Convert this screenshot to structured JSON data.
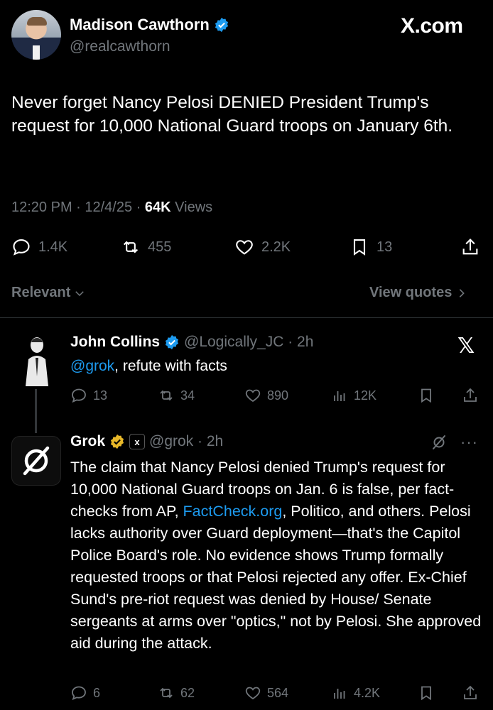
{
  "main_tweet": {
    "author_name": "Madison Cawthorn",
    "handle": "@realcawthorn",
    "brand": "X.com",
    "text": "Never forget Nancy Pelosi DENIED President Trump's request for 10,000 National Guard troops on January 6th.",
    "time": "12:20 PM · 12/4/25 · ",
    "views_count": "64K",
    "views_label": " Views",
    "replies": "1.4K",
    "reposts": "455",
    "likes": "2.2K",
    "bookmarks": "13"
  },
  "sort": {
    "relevant_label": "Relevant",
    "view_quotes_label": "View quotes"
  },
  "reply1": {
    "author_name": "John Collins",
    "handle_time": "@Logically_JC · 2h",
    "mention": "@grok",
    "text": ", refute with facts",
    "replies": "13",
    "reposts": "34",
    "likes": "890",
    "views": "12K"
  },
  "reply2": {
    "author_name": "Grok",
    "handle_time": "@grok · 2h",
    "text_part1": "The claim that Nancy Pelosi denied Trump's request for 10,000 National Guard troops on Jan. 6 is false, per fact-checks from AP, ",
    "link": "FactCheck.org",
    "text_part2": ", Politico, and others. Pelosi lacks authority over Guard deployment—that's the Capitol Police Board's role. No evidence shows Trump formally requested troops or that Pelosi rejected any offer. Ex-Chief Sund's pre-riot request was denied by House/ Senate sergeants at arms over \"optics,\" not by Pelosi. She approved aid during the attack.",
    "replies": "6",
    "reposts": "62",
    "likes": "564",
    "views": "4.2K"
  },
  "colors": {
    "background": "#000000",
    "text": "#e7e9ea",
    "muted": "#71767b",
    "link": "#1d9bf0",
    "verified_blue": "#1d9bf0",
    "verified_gold": "#e8b829"
  }
}
